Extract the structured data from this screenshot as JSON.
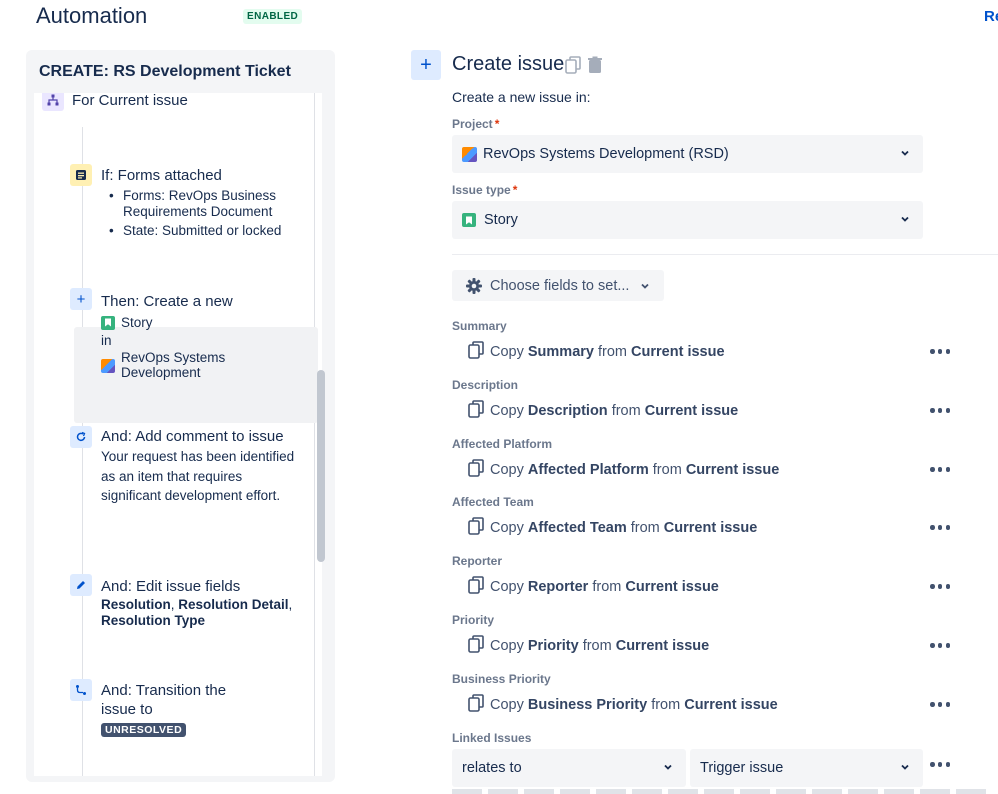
{
  "header": {
    "title": "Automation",
    "status": "ENABLED",
    "return_link": "Re"
  },
  "rule": {
    "name": "CREATE: RS Development Ticket",
    "branch": {
      "label": "For Current issue",
      "icon": "branch-icon"
    },
    "condition": {
      "title": "If: Forms attached",
      "icon": "form-icon",
      "bullets": [
        "Forms: RevOps Business Requirements Document",
        "State: Submitted or locked"
      ]
    },
    "create_action": {
      "title": "Then: Create a new",
      "issue_type": "Story",
      "in_label": "in",
      "project": "RevOps Systems Development",
      "icon": "plus-icon"
    },
    "comment_action": {
      "title": "And: Add comment to issue",
      "body": "Your request has been identified as an item that requires significant development effort.",
      "icon": "comment-refresh-icon"
    },
    "edit_action": {
      "title": "And: Edit issue fields",
      "field1": "Resolution",
      "sep1": ", ",
      "field2": "Resolution Detail",
      "sep2": ",",
      "field3": "Resolution Type",
      "icon": "pencil-icon"
    },
    "transition_action": {
      "title": "And: Transition the issue to",
      "status": "UNRESOLVED",
      "icon": "transition-icon"
    }
  },
  "action_panel": {
    "title": "Create issue",
    "subtitle": "Create a new issue in:",
    "project_label": "Project",
    "project_value": "RevOps Systems Development (RSD)",
    "issue_type_label": "Issue type",
    "issue_type_value": "Story",
    "choose_fields": "Choose fields to set...",
    "copy_word": "Copy",
    "from_word": "from",
    "source": "Current issue",
    "fields": [
      {
        "label": "Summary",
        "field": "Summary"
      },
      {
        "label": "Description",
        "field": "Description"
      },
      {
        "label": "Affected Platform",
        "field": "Affected Platform"
      },
      {
        "label": "Affected Team",
        "field": "Affected Team"
      },
      {
        "label": "Reporter",
        "field": "Reporter"
      },
      {
        "label": "Priority",
        "field": "Priority"
      },
      {
        "label": "Business Priority",
        "field": "Business Priority"
      }
    ],
    "linked_issues": {
      "label": "Linked Issues",
      "relation": "relates to",
      "target": "Trigger issue"
    }
  },
  "colors": {
    "accent": "#0052cc",
    "enabled_bg": "#e3fcef",
    "enabled_text": "#006644",
    "story_green": "#36b37e",
    "required_red": "#de350b"
  }
}
